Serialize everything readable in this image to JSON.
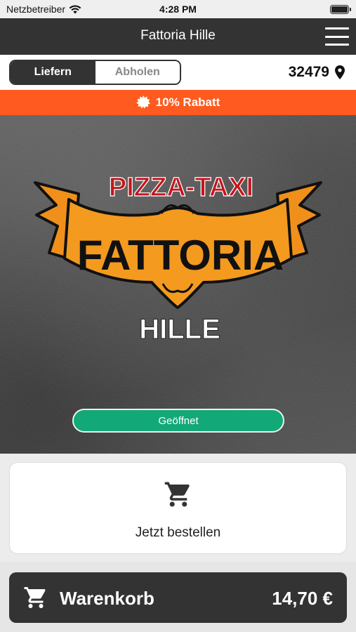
{
  "status_bar": {
    "carrier": "Netzbetreiber",
    "time": "4:28 PM",
    "icons": [
      "wifi-icon",
      "battery-icon"
    ]
  },
  "header": {
    "title": "Fattoria Hille",
    "menu_icon": "hamburger-menu-icon"
  },
  "mode_toggle": {
    "options": [
      {
        "label": "Liefern",
        "selected": true
      },
      {
        "label": "Abholen",
        "selected": false
      }
    ]
  },
  "location": {
    "zip": "32479",
    "icon": "location-pin-icon"
  },
  "discount": {
    "text": "10% Rabatt",
    "icon": "badge-icon",
    "color": "#ff5a1f"
  },
  "hero": {
    "logo": {
      "top_line": "PIZZA-TAXI",
      "banner": "FATTORIA",
      "bottom_line": "HILLE"
    },
    "status": "Geöffnet",
    "status_color": "#12a877"
  },
  "order_card": {
    "label": "Jetzt bestellen",
    "icon": "shopping-cart-icon"
  },
  "cart_bar": {
    "label": "Warenkorb",
    "total": "14,70 €",
    "icon": "shopping-cart-icon"
  },
  "colors": {
    "header": "#333333",
    "accent_orange": "#ff5a1f",
    "open_green": "#12a877"
  }
}
